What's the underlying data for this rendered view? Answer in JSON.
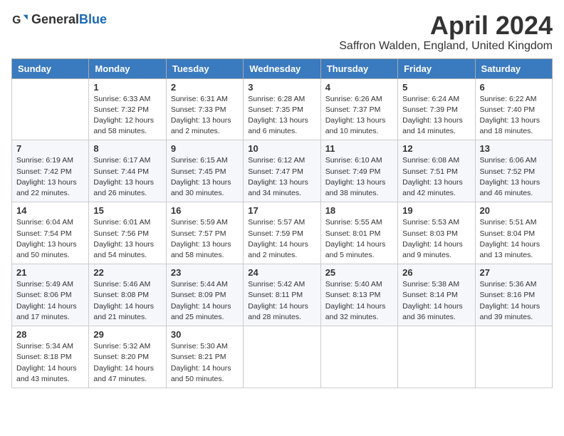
{
  "header": {
    "logo_general": "General",
    "logo_blue": "Blue",
    "month_title": "April 2024",
    "location": "Saffron Walden, England, United Kingdom"
  },
  "days_of_week": [
    "Sunday",
    "Monday",
    "Tuesday",
    "Wednesday",
    "Thursday",
    "Friday",
    "Saturday"
  ],
  "weeks": [
    [
      {
        "day": "",
        "info": ""
      },
      {
        "day": "1",
        "info": "Sunrise: 6:33 AM\nSunset: 7:32 PM\nDaylight: 12 hours\nand 58 minutes."
      },
      {
        "day": "2",
        "info": "Sunrise: 6:31 AM\nSunset: 7:33 PM\nDaylight: 13 hours\nand 2 minutes."
      },
      {
        "day": "3",
        "info": "Sunrise: 6:28 AM\nSunset: 7:35 PM\nDaylight: 13 hours\nand 6 minutes."
      },
      {
        "day": "4",
        "info": "Sunrise: 6:26 AM\nSunset: 7:37 PM\nDaylight: 13 hours\nand 10 minutes."
      },
      {
        "day": "5",
        "info": "Sunrise: 6:24 AM\nSunset: 7:39 PM\nDaylight: 13 hours\nand 14 minutes."
      },
      {
        "day": "6",
        "info": "Sunrise: 6:22 AM\nSunset: 7:40 PM\nDaylight: 13 hours\nand 18 minutes."
      }
    ],
    [
      {
        "day": "7",
        "info": "Sunrise: 6:19 AM\nSunset: 7:42 PM\nDaylight: 13 hours\nand 22 minutes."
      },
      {
        "day": "8",
        "info": "Sunrise: 6:17 AM\nSunset: 7:44 PM\nDaylight: 13 hours\nand 26 minutes."
      },
      {
        "day": "9",
        "info": "Sunrise: 6:15 AM\nSunset: 7:45 PM\nDaylight: 13 hours\nand 30 minutes."
      },
      {
        "day": "10",
        "info": "Sunrise: 6:12 AM\nSunset: 7:47 PM\nDaylight: 13 hours\nand 34 minutes."
      },
      {
        "day": "11",
        "info": "Sunrise: 6:10 AM\nSunset: 7:49 PM\nDaylight: 13 hours\nand 38 minutes."
      },
      {
        "day": "12",
        "info": "Sunrise: 6:08 AM\nSunset: 7:51 PM\nDaylight: 13 hours\nand 42 minutes."
      },
      {
        "day": "13",
        "info": "Sunrise: 6:06 AM\nSunset: 7:52 PM\nDaylight: 13 hours\nand 46 minutes."
      }
    ],
    [
      {
        "day": "14",
        "info": "Sunrise: 6:04 AM\nSunset: 7:54 PM\nDaylight: 13 hours\nand 50 minutes."
      },
      {
        "day": "15",
        "info": "Sunrise: 6:01 AM\nSunset: 7:56 PM\nDaylight: 13 hours\nand 54 minutes."
      },
      {
        "day": "16",
        "info": "Sunrise: 5:59 AM\nSunset: 7:57 PM\nDaylight: 13 hours\nand 58 minutes."
      },
      {
        "day": "17",
        "info": "Sunrise: 5:57 AM\nSunset: 7:59 PM\nDaylight: 14 hours\nand 2 minutes."
      },
      {
        "day": "18",
        "info": "Sunrise: 5:55 AM\nSunset: 8:01 PM\nDaylight: 14 hours\nand 5 minutes."
      },
      {
        "day": "19",
        "info": "Sunrise: 5:53 AM\nSunset: 8:03 PM\nDaylight: 14 hours\nand 9 minutes."
      },
      {
        "day": "20",
        "info": "Sunrise: 5:51 AM\nSunset: 8:04 PM\nDaylight: 14 hours\nand 13 minutes."
      }
    ],
    [
      {
        "day": "21",
        "info": "Sunrise: 5:49 AM\nSunset: 8:06 PM\nDaylight: 14 hours\nand 17 minutes."
      },
      {
        "day": "22",
        "info": "Sunrise: 5:46 AM\nSunset: 8:08 PM\nDaylight: 14 hours\nand 21 minutes."
      },
      {
        "day": "23",
        "info": "Sunrise: 5:44 AM\nSunset: 8:09 PM\nDaylight: 14 hours\nand 25 minutes."
      },
      {
        "day": "24",
        "info": "Sunrise: 5:42 AM\nSunset: 8:11 PM\nDaylight: 14 hours\nand 28 minutes."
      },
      {
        "day": "25",
        "info": "Sunrise: 5:40 AM\nSunset: 8:13 PM\nDaylight: 14 hours\nand 32 minutes."
      },
      {
        "day": "26",
        "info": "Sunrise: 5:38 AM\nSunset: 8:14 PM\nDaylight: 14 hours\nand 36 minutes."
      },
      {
        "day": "27",
        "info": "Sunrise: 5:36 AM\nSunset: 8:16 PM\nDaylight: 14 hours\nand 39 minutes."
      }
    ],
    [
      {
        "day": "28",
        "info": "Sunrise: 5:34 AM\nSunset: 8:18 PM\nDaylight: 14 hours\nand 43 minutes."
      },
      {
        "day": "29",
        "info": "Sunrise: 5:32 AM\nSunset: 8:20 PM\nDaylight: 14 hours\nand 47 minutes."
      },
      {
        "day": "30",
        "info": "Sunrise: 5:30 AM\nSunset: 8:21 PM\nDaylight: 14 hours\nand 50 minutes."
      },
      {
        "day": "",
        "info": ""
      },
      {
        "day": "",
        "info": ""
      },
      {
        "day": "",
        "info": ""
      },
      {
        "day": "",
        "info": ""
      }
    ]
  ]
}
